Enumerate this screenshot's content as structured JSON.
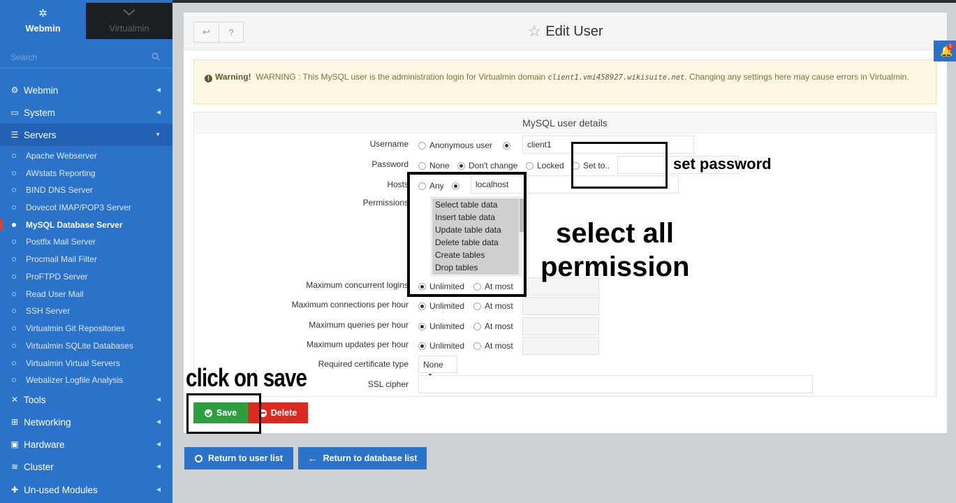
{
  "switcher": {
    "webmin_label": "Webmin",
    "virtualmin_label": "Virtualmin"
  },
  "search": {
    "placeholder": "Search"
  },
  "nav": {
    "categories": [
      {
        "label": "Webmin"
      },
      {
        "label": "System"
      },
      {
        "label": "Servers"
      },
      {
        "label": "Tools"
      },
      {
        "label": "Networking"
      },
      {
        "label": "Hardware"
      },
      {
        "label": "Cluster"
      },
      {
        "label": "Un-used Modules"
      }
    ],
    "modules": [
      {
        "label": "Apache Webserver"
      },
      {
        "label": "AWstats Reporting"
      },
      {
        "label": "BIND DNS Server"
      },
      {
        "label": "Dovecot IMAP/POP3 Server"
      },
      {
        "label": "MySQL Database Server"
      },
      {
        "label": "Postfix Mail Server"
      },
      {
        "label": "Procmail Mail Filter"
      },
      {
        "label": "ProFTPD Server"
      },
      {
        "label": "Read User Mail"
      },
      {
        "label": "SSH Server"
      },
      {
        "label": "Virtualmin Git Repositories"
      },
      {
        "label": "Virtualmin SQLite Databases"
      },
      {
        "label": "Virtualmin Virtual Servers"
      },
      {
        "label": "Webalizer Logfile Analysis"
      }
    ]
  },
  "header": {
    "title": "Edit User"
  },
  "alert": {
    "strong": "Warning!",
    "text_before": "WARNING : This MySQL user is the administration login for Virtualmin domain",
    "domain": "client1.vmi458927.wikisuite.net",
    "text_after": ". Changing any settings here may cause errors in Virtualmin."
  },
  "form": {
    "section_title": "MySQL user details",
    "username": {
      "label": "Username",
      "opt_anonymous": "Anonymous user",
      "value": "client1"
    },
    "password": {
      "label": "Password",
      "opt_none": "None",
      "opt_dont_change": "Don't change",
      "opt_locked": "Locked",
      "opt_set_to": "Set to.."
    },
    "hosts": {
      "label": "Hosts",
      "opt_any": "Any",
      "value": "localhost"
    },
    "permissions": {
      "label": "Permissions",
      "options": [
        "Select table data",
        "Insert table data",
        "Update table data",
        "Delete table data",
        "Create tables",
        "Drop tables"
      ]
    },
    "limits": [
      {
        "label": "Maximum concurrent logins",
        "opt_unlimited": "Unlimited",
        "opt_at_most": "At most"
      },
      {
        "label": "Maximum connections per hour",
        "opt_unlimited": "Unlimited",
        "opt_at_most": "At most"
      },
      {
        "label": "Maximum queries per hour",
        "opt_unlimited": "Unlimited",
        "opt_at_most": "At most"
      },
      {
        "label": "Maximum updates per hour",
        "opt_unlimited": "Unlimited",
        "opt_at_most": "At most"
      }
    ],
    "cert": {
      "label": "Required certificate type",
      "value": "None"
    },
    "cipher": {
      "label": "SSL cipher"
    }
  },
  "buttons": {
    "save": "Save",
    "delete": "Delete",
    "return_users": "Return to user list",
    "return_db": "Return to database list"
  },
  "notification": {
    "count": "1"
  },
  "annotations": {
    "set_password": "set password",
    "select_all_line1": "select all",
    "select_all_line2": "permission",
    "click_save": "click on save"
  },
  "colors": {
    "sidebar": "#2b72c9",
    "save": "#2e9f3e",
    "delete": "#d92b20",
    "warning_bg": "#fcf8e3"
  }
}
